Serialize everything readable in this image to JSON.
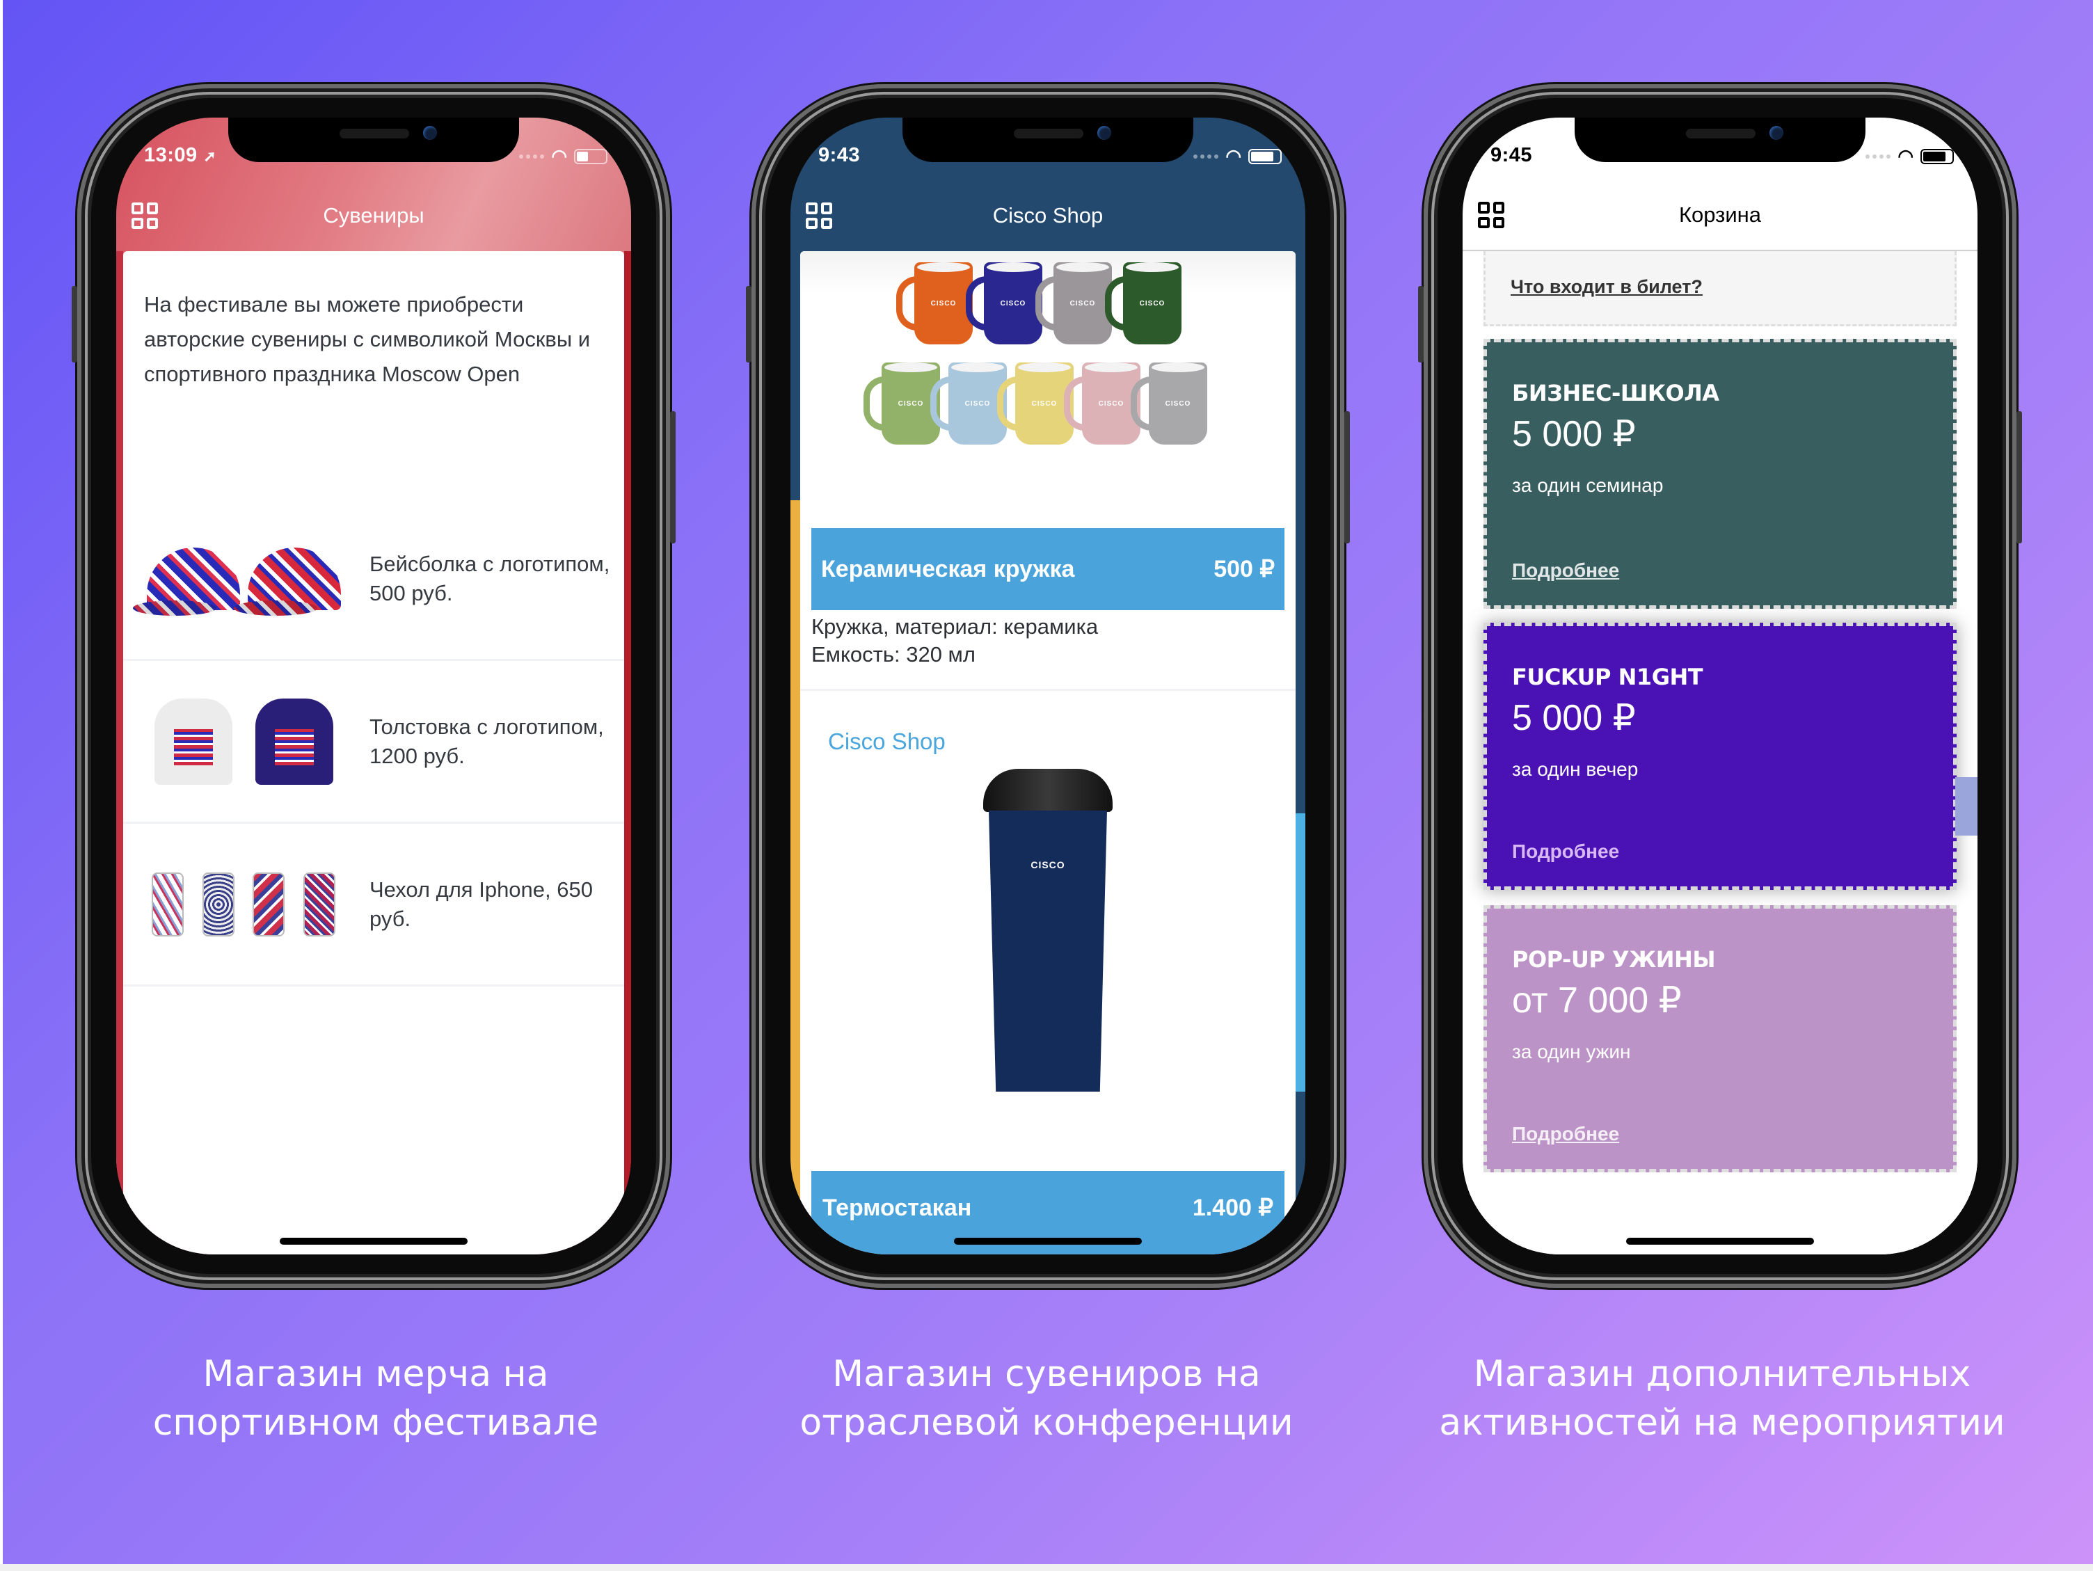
{
  "phones": [
    {
      "status": {
        "time": "13:09",
        "location_icon": "location-arrow-icon"
      },
      "nav_title": "Сувениры",
      "intro": "На фестивале вы можете приобрести авторские сувениры с символикой Москвы и спортивного праздника Moscow Open",
      "items": [
        {
          "label": "Бейсболка с логотипом, 500 руб.",
          "image": "baseball-caps"
        },
        {
          "label": "Толстовка с логотипом, 1200 руб.",
          "image": "hoodies"
        },
        {
          "label": "Чехол для Iphone, 650 руб.",
          "image": "phone-cases"
        }
      ],
      "accent": "#d6525f"
    },
    {
      "status": {
        "time": "9:43"
      },
      "nav_title": "Cisco Shop",
      "products": [
        {
          "name": "Керамическая кружка",
          "price": "500 ₽",
          "description_lines": [
            "Кружка, материал: керамика",
            "Емкость: 320 мл"
          ]
        },
        {
          "name": "Термостакан",
          "price": "1.400 ₽"
        }
      ],
      "shop_link": "Cisco Shop",
      "mug_logo": "CISCO",
      "mug_colors": [
        "#e0601e",
        "#2a2790",
        "#9a9699",
        "#2c5a2a",
        "#92b26a",
        "#a8c6dc",
        "#e6d47a",
        "#dcb2b6",
        "#a8a8aa"
      ],
      "accent": "#234a6e",
      "pricebar_color": "#4ba3db"
    },
    {
      "status": {
        "time": "9:45"
      },
      "nav_title": "Корзина",
      "info_link": "Что входит в билет?",
      "tickets": [
        {
          "title": "БИЗНЕС-ШКОЛА",
          "price": "5 000 ₽",
          "subtitle": "за один семинар",
          "link": "Подробнее",
          "color": "#385e5f"
        },
        {
          "title": "FUCKUP N1GHT",
          "price": "5 000 ₽",
          "subtitle": "за один вечер",
          "link": "Подробнее",
          "color": "#4a12b4"
        },
        {
          "title": "POP-UP УЖИНЫ",
          "price": "от 7 000 ₽",
          "subtitle": "за один ужин",
          "link": "Подробнее",
          "color": "#bc93c6"
        }
      ]
    }
  ],
  "captions": [
    [
      "Магазин мерча на",
      "спортивном фестивале"
    ],
    [
      "Магазин сувениров на",
      "отраслевой конференции"
    ],
    [
      "Магазин дополнительных",
      "активностей на мероприятии"
    ]
  ]
}
